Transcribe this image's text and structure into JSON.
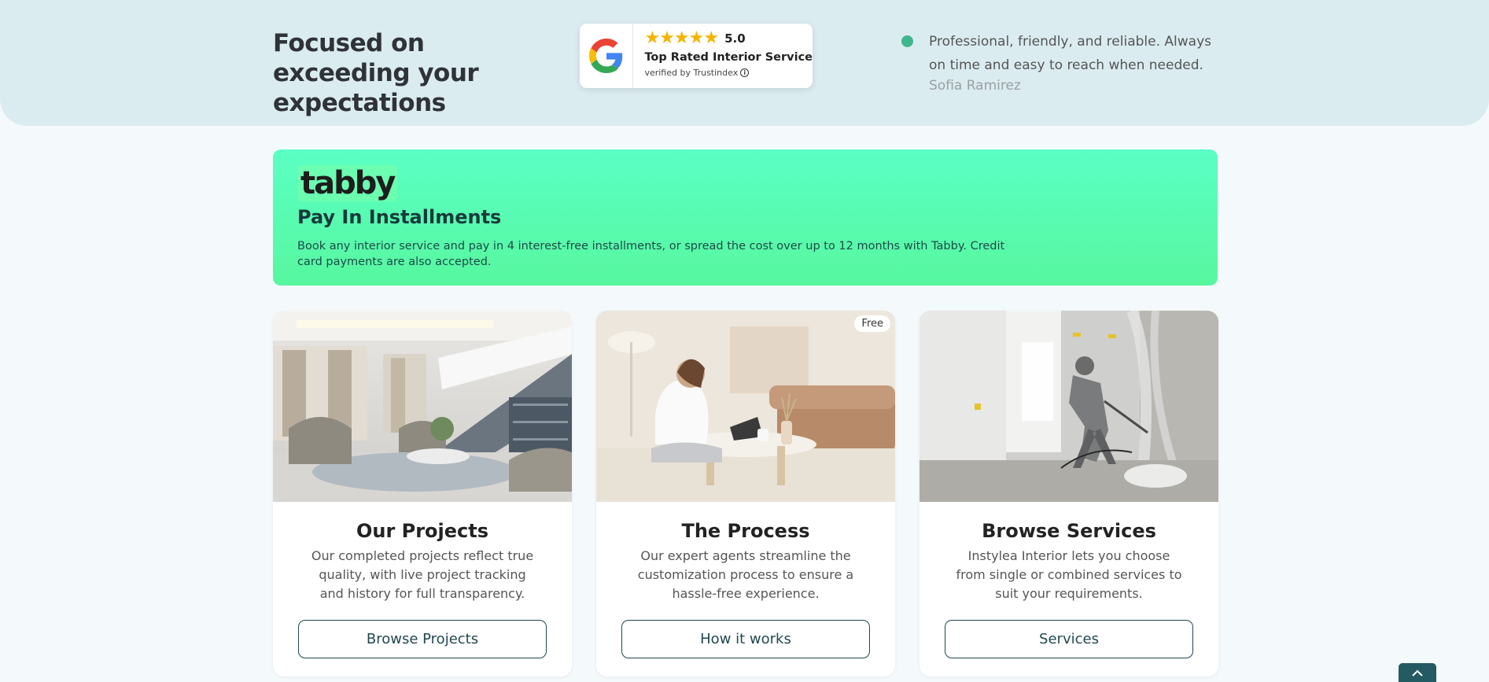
{
  "hero": {
    "title": "Focused on exceeding your expectations",
    "review_badge": {
      "stars": "★★★★★",
      "rating": "5.0",
      "title": "Top Rated Interior Service",
      "verified": "verified by Trustindex",
      "info_icon_glyph": "i"
    },
    "testimonial": {
      "text": "Professional, friendly, and reliable. Always on time and easy to reach when needed.",
      "author": "Sofia Ramirez"
    }
  },
  "tabby": {
    "logo": "tabby",
    "title": "Pay In Installments",
    "description": "Book any interior service and pay in 4 interest-free installments, or spread the cost over up to 12 months with Tabby. Credit card payments are also accepted."
  },
  "cards": [
    {
      "title": "Our Projects",
      "description": "Our completed projects reflect true quality, with live project tracking and history for full transparency.",
      "button": "Browse Projects",
      "image": "living-room-with-staircase-image"
    },
    {
      "title": "The Process",
      "description": "Our expert agents streamline the customization process to ensure a hassle-free experience.",
      "button": "How it works",
      "badge": "Free",
      "image": "woman-working-on-laptop-image"
    },
    {
      "title": "Browse Services",
      "description": "Instylea Interior lets you choose from single or combined services to suit your requirements.",
      "button": "Services",
      "image": "painter-spraying-wall-image"
    }
  ],
  "colors": {
    "hero_bg": "#dbecf0",
    "tabby_green": "#5affc4",
    "star_gold": "#f4b400",
    "accent_dot": "#3fb68b",
    "button_border": "#1f4850",
    "back_to_top_bg": "#245a62"
  },
  "icons": {
    "google": "google-g-icon",
    "back_to_top": "chevron-up-icon"
  }
}
